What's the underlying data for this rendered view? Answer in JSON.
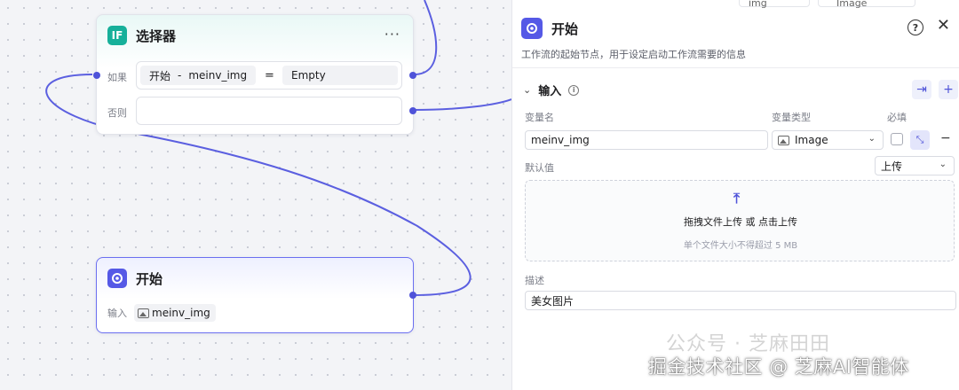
{
  "selector_node": {
    "icon_text": "IF",
    "title": "选择器",
    "more": "···",
    "if_label": "如果",
    "left_node": "开始",
    "left_separator": "-",
    "left_var": "meinv_img",
    "operator": "=",
    "right_value": "Empty",
    "else_label": "否则"
  },
  "start_node": {
    "title": "开始",
    "input_label": "输入",
    "input_var": "meinv_img"
  },
  "panel": {
    "title": "开始",
    "description": "工作流的起始节点，用于设定启动工作流需要的信息",
    "help": "?",
    "close": "✕",
    "section_title": "输入",
    "section_info": "i",
    "col_var_name": "变量名",
    "col_var_type": "变量类型",
    "col_required": "必填",
    "var_name_value": "meinv_img",
    "var_type_value": "Image",
    "default_label": "默认值",
    "default_mode": "上传",
    "upload_main": "拖拽文件上传 或 点击上传",
    "upload_sub": "单个文件大小不得超过 5 MB",
    "desc_label": "描述",
    "desc_value": "美女图片",
    "peek_left": "img",
    "peek_right": "Image"
  },
  "watermark": {
    "line_faint": "公众号 · 芝麻田田",
    "line_main": "掘金技术社区 @ 芝麻AI智能体"
  },
  "colors": {
    "accent": "#4f53d9",
    "if_icon": "#17b09a",
    "start_icon": "#5559e6"
  },
  "icons": [
    "start-node-icon",
    "image-icon",
    "help-icon",
    "close-icon",
    "import-icon",
    "plus-icon",
    "collapse-icon",
    "upload-icon",
    "chevron-down-icon",
    "info-icon"
  ]
}
